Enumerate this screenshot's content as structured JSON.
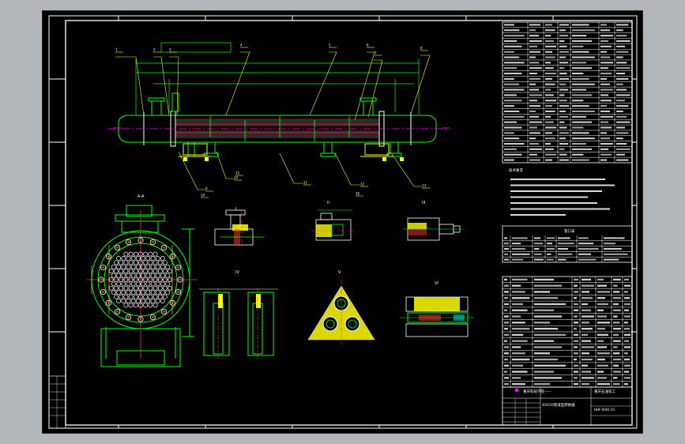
{
  "drawing": {
    "title_block": {
      "school": "重庆科技学院——",
      "design_title": "XX150管道型转换器",
      "logo_caption": "重庆石油化工",
      "drawing_no": "HHF-0001-01"
    },
    "sections": {
      "tech_notes_title": "技术要求",
      "nozzle_table_title": "管口表",
      "front_view_label": "A-A",
      "detail_labels": [
        "I",
        "II",
        "III",
        "IV",
        "V",
        "VI"
      ],
      "balloon_labels": [
        "1",
        "2",
        "3",
        "4",
        "5",
        "6",
        "7",
        "8",
        "9",
        "10",
        "11",
        "12",
        "13",
        "14",
        "15",
        "16"
      ]
    },
    "colors": {
      "background": "#000000",
      "frame": "#ffffff",
      "outline_green": "#00ff00",
      "tube_red": "#ff3030",
      "center_magenta": "#ff00ff",
      "hatch_yellow": "#ffff00",
      "tube_cyan": "#00ffff",
      "table_text": "#ffffff"
    }
  }
}
